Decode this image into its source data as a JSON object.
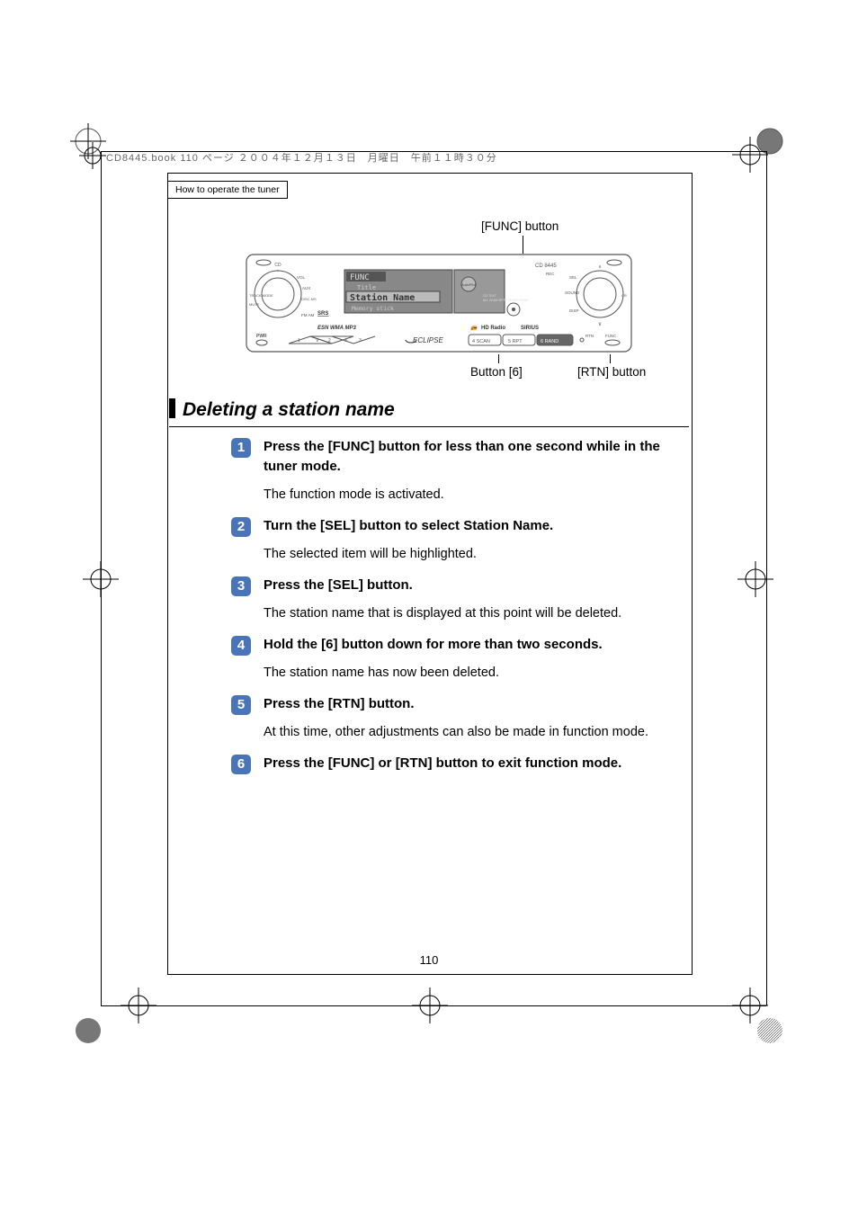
{
  "print_header": "CD8445.book  110 ページ  ２００４年１２月１３日　月曜日　午前１１時３０分",
  "breadcrumb": "How to operate the tuner",
  "callouts": {
    "func": "[FUNC] button",
    "btn6": "Button [6]",
    "rtn": "[RTN] button"
  },
  "device": {
    "model": "CD 8445",
    "screen_top": "FUNC",
    "screen_mid": "Title",
    "screen_main": "Station Name",
    "screen_bot": "Memory stick",
    "brand": "ECLIPSE",
    "labels": {
      "cd": "CD",
      "vol": "VOL",
      "aux": "AUX",
      "disc_ms": "DISC\nMS",
      "mute": "MUTE",
      "fm_am": "FM\nAM",
      "pwr": "PWR",
      "srs": "SRS",
      "esn": "ESN WMA MP3",
      "rec": "REC",
      "sel": "SEL",
      "sound": "SOUND",
      "disp": "DISP",
      "cr": "CR",
      "func": "FUNC",
      "rtn": "RTN",
      "audio_pilot": "AudioPilot",
      "hd": "HD Radio",
      "sirius": "SIRIUS",
      "btn1": "1",
      "btn2": "2",
      "btn3": "3",
      "btn4": "4  SCAN",
      "btn5": "5   RPT",
      "btn6": "6  RAND",
      "track_mode": "TRACK MODE",
      "scan_labels": "ALL SCAN RPT\nFOLDER RAND"
    }
  },
  "section_title": "Deleting a station name",
  "steps": [
    {
      "n": "1",
      "bold": "Press the [FUNC] button for less than one second while in the tuner mode.",
      "desc": "The function mode is activated."
    },
    {
      "n": "2",
      "bold": "Turn the [SEL] button to select Station Name.",
      "desc": "The selected item will be highlighted."
    },
    {
      "n": "3",
      "bold": "Press the [SEL] button.",
      "desc": "The station name that is displayed at this point will be deleted."
    },
    {
      "n": "4",
      "bold": "Hold the [6] button down for more than two seconds.",
      "desc": "The station name has now been deleted."
    },
    {
      "n": "5",
      "bold": "Press the [RTN] button.",
      "desc": "At this time, other adjustments can also be made in function mode."
    },
    {
      "n": "6",
      "bold": "Press the [FUNC] or [RTN] button to exit function mode.",
      "desc": ""
    }
  ],
  "page_number": "110"
}
